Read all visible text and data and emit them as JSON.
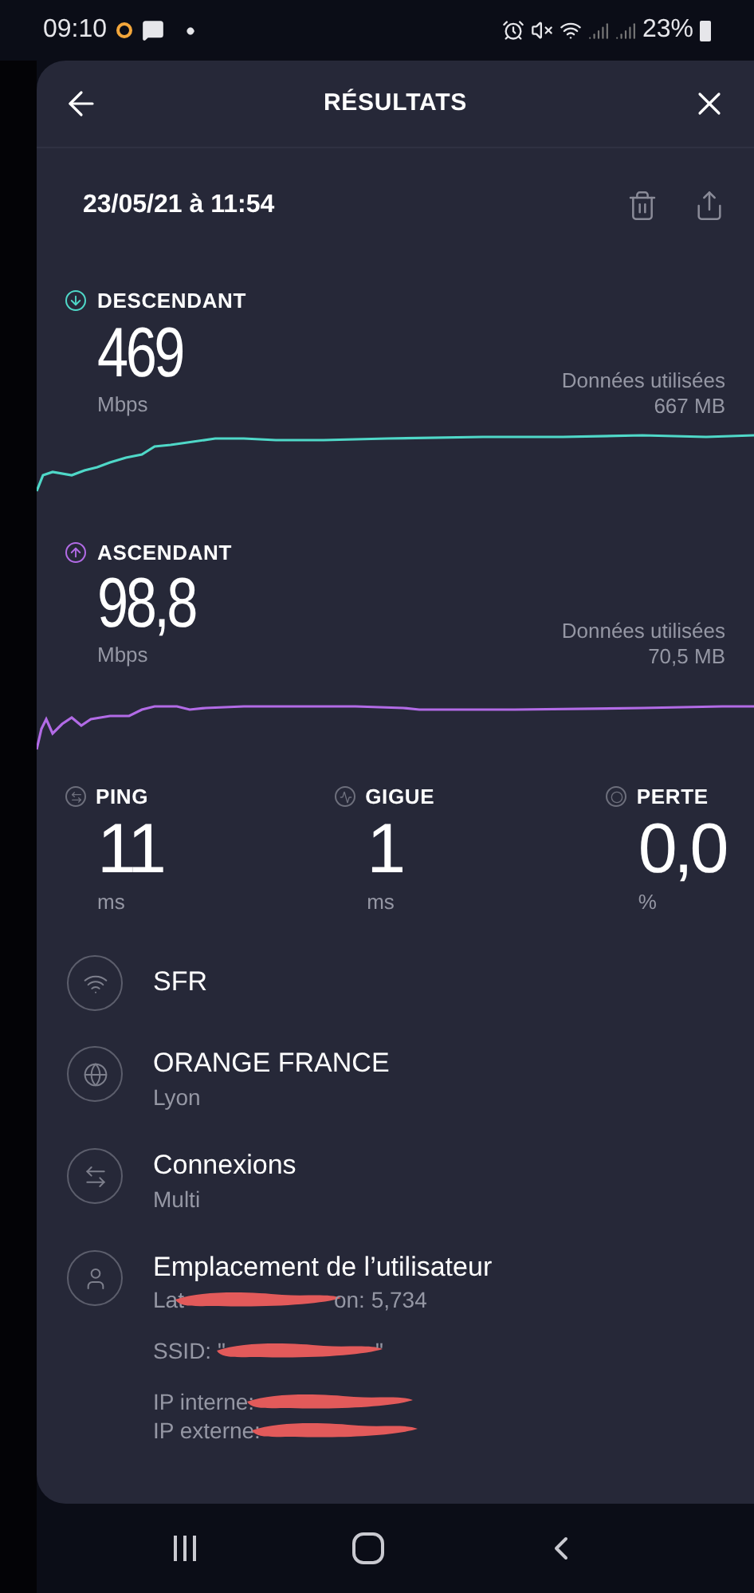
{
  "status_bar": {
    "time": "09:10",
    "battery": "23%"
  },
  "header": {
    "title": "RÉSULTATS"
  },
  "date": "23/05/21 à 11:54",
  "speeds": [
    {
      "kind": "download",
      "label": "DESCENDANT",
      "value": "469",
      "unit": "Mbps",
      "data_label": "Données utilisées",
      "data_value": "667 MB",
      "color": "#4fd8c8"
    },
    {
      "kind": "upload",
      "label": "ASCENDANT",
      "value": "98,8",
      "unit": "Mbps",
      "data_label": "Données utilisées",
      "data_value": "70,5 MB",
      "color": "#b26be6"
    }
  ],
  "metrics": [
    {
      "kind": "ping",
      "label": "PING",
      "value": "11",
      "unit": "ms"
    },
    {
      "kind": "jitter",
      "label": "GIGUE",
      "value": "1",
      "unit": "ms"
    },
    {
      "kind": "loss",
      "label": "PERTE",
      "value": "0,0",
      "unit": "%"
    }
  ],
  "info": [
    {
      "kind": "wifi",
      "title": "SFR"
    },
    {
      "kind": "globe",
      "title": "ORANGE FRANCE",
      "subtitle": "Lyon"
    },
    {
      "kind": "connections",
      "title": "Connexions",
      "subtitle": "Multi"
    },
    {
      "kind": "user",
      "title": "Emplacement de l’utilisateur",
      "details": [
        [
          {
            "kind": "text",
            "text": "Lat"
          },
          {
            "kind": "redaction"
          },
          {
            "kind": "text",
            "text": "on: 5,734"
          }
        ],
        [
          {
            "kind": "text",
            "text": "SSID: \""
          },
          {
            "kind": "redaction"
          },
          {
            "kind": "text",
            "text": "\""
          }
        ],
        [
          {
            "kind": "text",
            "text": "IP interne:"
          },
          {
            "kind": "redaction"
          }
        ],
        [
          {
            "kind": "text",
            "text": "IP externe:"
          },
          {
            "kind": "redaction"
          }
        ]
      ]
    }
  ]
}
